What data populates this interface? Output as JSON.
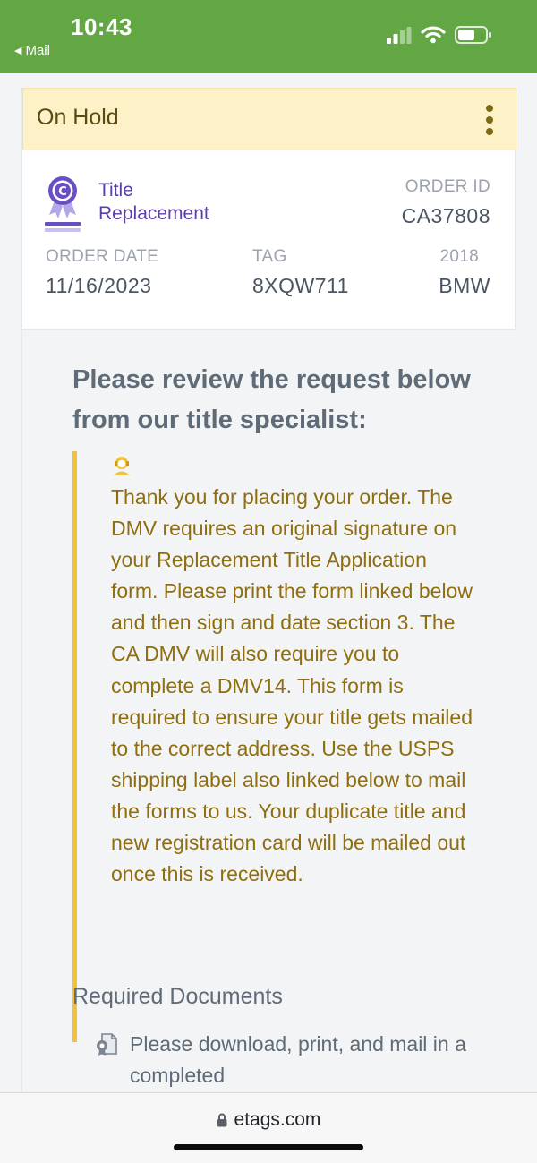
{
  "status_bar": {
    "time": "10:43",
    "back_label": "Mail",
    "icons": [
      "cellular-signal-icon",
      "wifi-icon",
      "battery-icon"
    ]
  },
  "order": {
    "status": "On Hold",
    "product_name": "Title Replacement",
    "order_id_label": "ORDER ID",
    "order_id": "CA37808",
    "order_date_label": "ORDER DATE",
    "order_date": "11/16/2023",
    "tag_label": "TAG",
    "tag": "8XQW711",
    "vehicle_year": "2018",
    "vehicle_make": "BMW"
  },
  "review": {
    "heading": "Please review the request below from our title specialist:",
    "message": "Thank you for placing your order. The DMV requires an original signature on your Replacement Title Application form. Please print the form linked below and then sign and date section 3. The CA DMV will also require you to complete a DMV14. This form is required to ensure your title gets mailed to the correct address. Use the USPS shipping label also linked below to mail the forms to us. Your duplicate title and new registration card will be mailed out once this is received."
  },
  "required_documents": {
    "heading": "Required Documents",
    "items": [
      "Please download, print, and mail in a completed"
    ]
  },
  "browser": {
    "url": "etags.com"
  },
  "colors": {
    "status_bar_green": "#62a744",
    "hold_banner": "#fdf2c7",
    "product_purple": "#5b3fa8",
    "message_gold": "#8f6e10",
    "quote_bar_yellow": "#f2c23c"
  }
}
